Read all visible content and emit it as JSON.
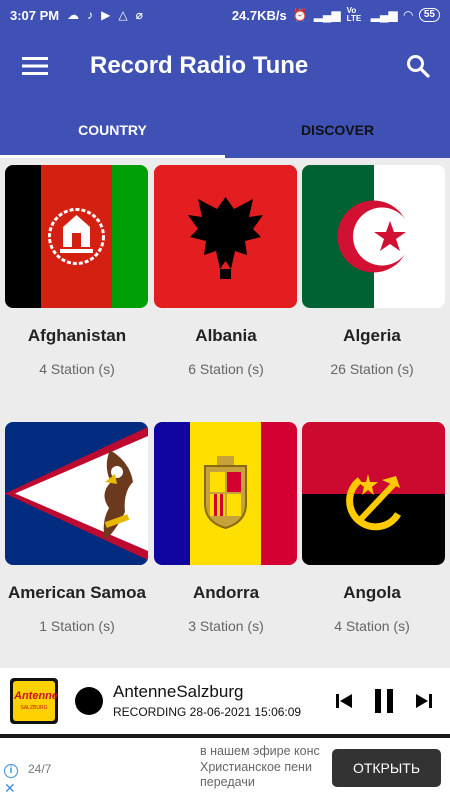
{
  "status_bar": {
    "time": "3:07 PM",
    "net_speed": "24.7KB/s",
    "network_type": "Vo LTE",
    "battery": "55"
  },
  "app_bar": {
    "title": "Record Radio Tune",
    "menu_icon": "hamburger-menu-icon",
    "search_icon": "search-icon"
  },
  "tabs": [
    {
      "label": "COUNTRY",
      "active": true
    },
    {
      "label": "DISCOVER",
      "active": false
    }
  ],
  "countries": [
    {
      "name": "Afghanistan",
      "stations": "4 Station (s)"
    },
    {
      "name": "Albania",
      "stations": "6 Station (s)"
    },
    {
      "name": "Algeria",
      "stations": "26 Station (s)"
    },
    {
      "name": "American Samoa",
      "stations": "1 Station (s)"
    },
    {
      "name": "Andorra",
      "stations": "3 Station (s)"
    },
    {
      "name": "Angola",
      "stations": "4 Station (s)"
    }
  ],
  "player": {
    "logo_text": "Antenne",
    "logo_subtext": "SALZBURG",
    "station": "AntenneSalzburg",
    "recording": "RECORDING 28-06-2021 15:06:09"
  },
  "ad": {
    "label": "24/7",
    "text_lines": [
      "в нашем эфире конс",
      "Христианское пени",
      "передачи"
    ],
    "cta": "ОТКРЫТЬ"
  },
  "colors": {
    "primary": "#3f51b5",
    "background": "#ececec"
  }
}
